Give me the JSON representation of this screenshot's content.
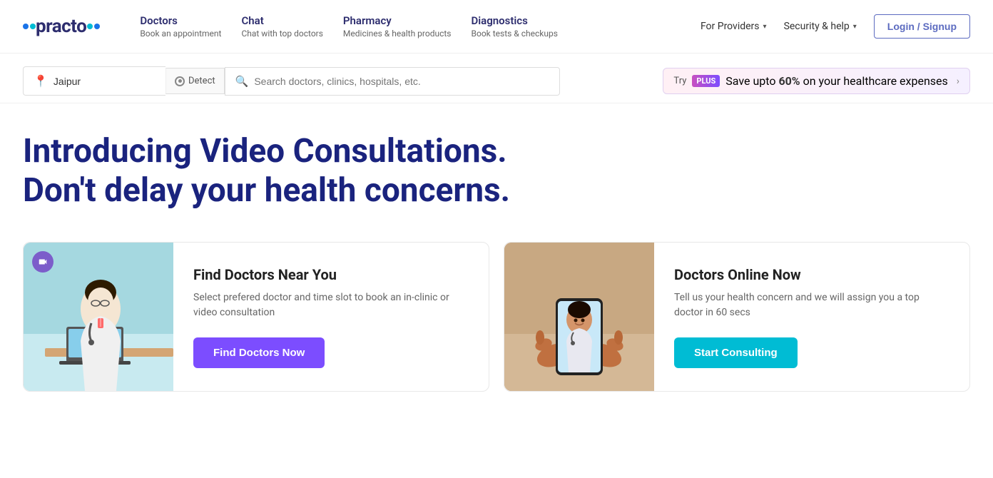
{
  "logo": {
    "text": "practo"
  },
  "nav": {
    "items": [
      {
        "id": "doctors",
        "main": "Doctors",
        "sub": "Book an appointment"
      },
      {
        "id": "chat",
        "main": "Chat",
        "sub": "Chat with top doctors"
      },
      {
        "id": "pharmacy",
        "main": "Pharmacy",
        "sub": "Medicines & health products"
      },
      {
        "id": "diagnostics",
        "main": "Diagnostics",
        "sub": "Book tests & checkups"
      }
    ],
    "for_providers": "For Providers",
    "security_help": "Security & help",
    "login_label": "Login / Signup"
  },
  "search": {
    "location_value": "Jaipur",
    "detect_label": "Detect",
    "placeholder": "Search doctors, clinics, hospitals, etc."
  },
  "plus_banner": {
    "try": "Try",
    "badge": "PLUS",
    "text": "Save upto ",
    "percent": "60%",
    "text2": " on your healthcare expenses"
  },
  "hero": {
    "line1": "Introducing Video Consultations.",
    "line2": "Don't delay your health concerns."
  },
  "card1": {
    "title": "Find Doctors Near You",
    "desc": "Select prefered doctor and time slot to book an in-clinic or video consultation",
    "button": "Find Doctors Now"
  },
  "card2": {
    "title": "Doctors Online Now",
    "desc": "Tell us your health concern and we will assign you a top doctor in 60 secs",
    "button": "Start Consulting"
  }
}
